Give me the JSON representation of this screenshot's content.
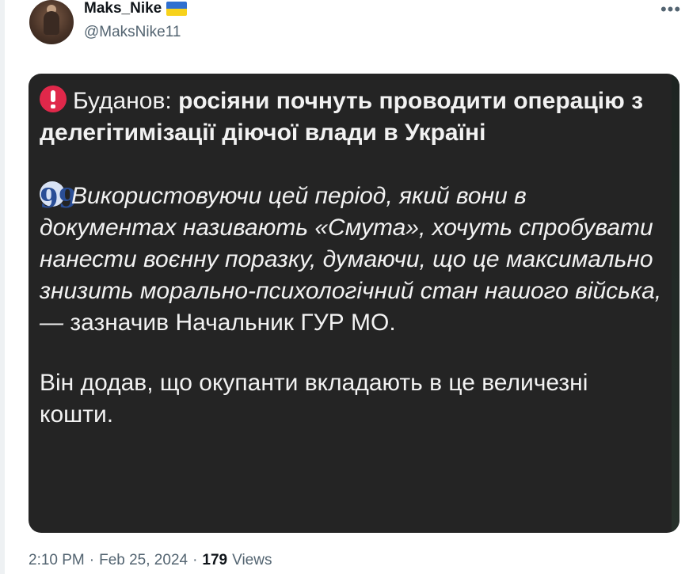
{
  "author": {
    "display_name": "Maks_Nike",
    "handle": "@MaksNike11",
    "flag_icon": "ukraine-flag-icon"
  },
  "more_icon": "•••",
  "card": {
    "headline_prefix": "Буданов: ",
    "headline_bold": "росіяни почнуть проводити операцію з делегітимізації діючої влади в Україні",
    "quote_icon": "99",
    "quote": "Використовуючи цей період, який вони в документах називають «Смута», хочуть спробувати нанести воєнну поразку, думаючи, що це максимально знизить морально-психологічний стан нашого війська, —",
    "attribution": "зазначив Начальник ГУР МО.",
    "closing": "Він додав, що окупанти вкладають в це величезні кошти."
  },
  "meta": {
    "time": "2:10 PM",
    "separator": "·",
    "date": "Feb 25, 2024",
    "views_count": "179",
    "views_label": "Views"
  },
  "colors": {
    "card_bg": "#242424",
    "alert_red": "#e0284a",
    "muted": "#536471",
    "text": "#0f1419"
  }
}
